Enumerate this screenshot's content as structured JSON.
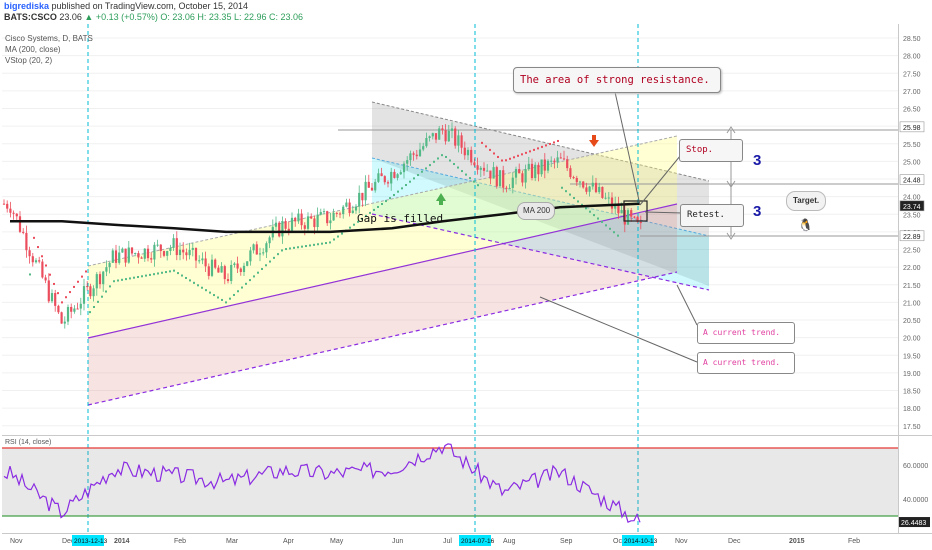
{
  "header": {
    "author": "bigrediska",
    "published": "published on TradingView.com, October 15, 2014",
    "symbol": "BATS:CSCO",
    "last": "23.06",
    "change": "▲ +0.13 (+0.57%)",
    "ohlc": [
      "O: 23.06",
      "H: 23.35",
      "L: 22.96",
      "C: 23.06"
    ]
  },
  "legend": {
    "title": "Cisco Systems, D, BATS",
    "ma": "MA (200, close)",
    "vstop": "VStop (20, 2)",
    "rsi": "RSI (14, close)"
  },
  "colors": {
    "up": "#53b987",
    "down": "#eb4d5c",
    "ma": "#111111",
    "rsi": "#8a2be2",
    "vline": "#00bcd4",
    "callout_text": "#b00020",
    "trend_text": "#e040a0",
    "number_blue": "#1a1aa8"
  },
  "price_axis": {
    "ticks": [
      "28.50",
      "28.00",
      "27.50",
      "27.00",
      "26.50",
      "26.00",
      "25.50",
      "25.00",
      "24.50",
      "24.00",
      "23.50",
      "23.00",
      "22.50",
      "22.00",
      "21.50",
      "21.00",
      "20.50",
      "20.00",
      "19.50",
      "19.00",
      "18.50",
      "18.00",
      "17.50"
    ],
    "markers": [
      {
        "label": "25.98",
        "style": "plain"
      },
      {
        "label": "24.48",
        "style": "plain"
      },
      {
        "label": "23.74",
        "style": "dark"
      },
      {
        "label": "22.89",
        "style": "plain"
      }
    ]
  },
  "rsi_axis": {
    "ticks": [
      "60.0000",
      "40.0000"
    ],
    "marker": "26.4483"
  },
  "time_axis": {
    "labels": [
      "Nov",
      "Dec",
      "2014",
      "Feb",
      "Mar",
      "Apr",
      "May",
      "Jun",
      "Jul",
      "Aug",
      "Sep",
      "Oct",
      "Nov",
      "Dec",
      "2015",
      "Feb"
    ],
    "highlighted": [
      "2013-12-13",
      "2014-07-16",
      "2014-10-13"
    ]
  },
  "annotations": {
    "resistance": "The area of strong resistance.",
    "stop": "Stop.",
    "retest": "Retest.",
    "target": "Target.",
    "gap": "Gap is filled.",
    "ma200": "MA 200",
    "trend1": "A current trend.",
    "trend2": "A current trend.",
    "three_a": "3",
    "three_b": "3"
  },
  "chart_data": {
    "type": "candlestick",
    "title": "Cisco Systems, D, BATS",
    "series": [
      {
        "name": "CSCO",
        "kind": "price",
        "x": [
          "2013-11",
          "2013-12",
          "2014-01",
          "2014-02",
          "2014-03",
          "2014-04",
          "2014-05",
          "2014-06",
          "2014-07",
          "2014-08",
          "2014-09",
          "2014-10"
        ],
        "values": [
          23.8,
          20.4,
          22.3,
          22.6,
          21.7,
          23.2,
          23.4,
          24.7,
          25.9,
          24.4,
          25.0,
          23.06
        ]
      },
      {
        "name": "MA (200, close)",
        "kind": "ma",
        "values": [
          23.3,
          23.3,
          23.2,
          23.1,
          23.0,
          23.0,
          23.0,
          23.1,
          23.3,
          23.5,
          23.7,
          23.8
        ]
      },
      {
        "name": "RSI (14, close)",
        "kind": "rsi",
        "values": [
          55,
          32,
          58,
          54,
          50,
          57,
          55,
          58,
          72,
          44,
          56,
          26.4
        ]
      }
    ],
    "levels": [
      25.98,
      24.48,
      23.74,
      22.89
    ],
    "ylim": [
      17.5,
      28.5
    ]
  }
}
